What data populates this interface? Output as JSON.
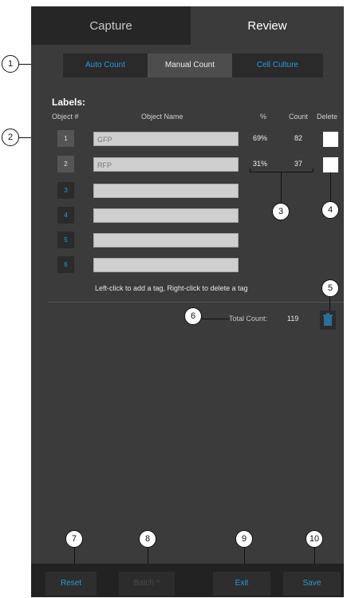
{
  "tabs": {
    "capture": "Capture",
    "review": "Review"
  },
  "modes": {
    "auto": "Auto Count",
    "manual": "Manual Count",
    "cell": "Cell Culture"
  },
  "labels": {
    "title": "Labels:",
    "headers": {
      "object": "Object #",
      "name": "Object Name",
      "pct": "%",
      "count": "Count",
      "delete": "Delete"
    },
    "rows": [
      {
        "num": "1",
        "name": "GFP",
        "pct": "69%",
        "count": "82"
      },
      {
        "num": "2",
        "name": "RFP",
        "pct": "31%",
        "count": "37"
      },
      {
        "num": "3",
        "name": ""
      },
      {
        "num": "4",
        "name": ""
      },
      {
        "num": "5",
        "name": ""
      },
      {
        "num": "6",
        "name": ""
      }
    ],
    "hint": "Left-click to add a tag, Right-click to delete a tag"
  },
  "total": {
    "label": "Total Count:",
    "value": "119"
  },
  "footer": {
    "reset": "Reset",
    "batch": "Batch ^",
    "exit": "Exit",
    "save": "Save"
  },
  "callouts": [
    "1",
    "2",
    "3",
    "4",
    "5",
    "6",
    "7",
    "8",
    "9",
    "10"
  ],
  "colors": {
    "accent": "#2a9ad8",
    "panel": "#3b3b3b",
    "dark": "#262626"
  },
  "icons": {
    "trash": "trash-icon"
  }
}
